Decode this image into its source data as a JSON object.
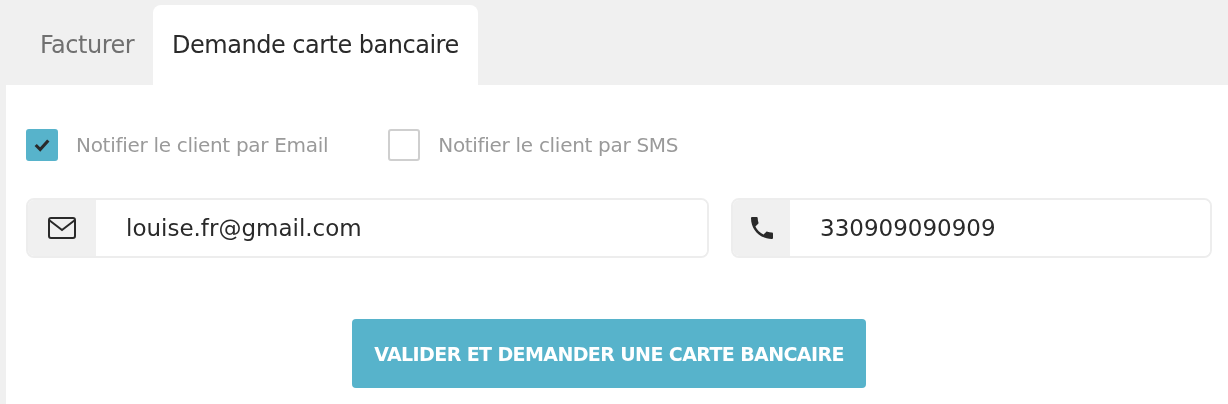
{
  "tabs": [
    {
      "label": "Facturer",
      "selected": false
    },
    {
      "label": "Demande carte bancaire",
      "selected": true
    }
  ],
  "notify_options": [
    {
      "label": "Notifier le client par Email",
      "checked": true
    },
    {
      "label": "Notifier le client par SMS",
      "checked": false
    }
  ],
  "fields": [
    {
      "kind": "email",
      "value": "louise.fr@gmail.com"
    },
    {
      "kind": "phone",
      "value": "330909090909"
    }
  ],
  "submit_button": "VALIDER ET DEMANDER UNE CARTE BANCAIRE"
}
